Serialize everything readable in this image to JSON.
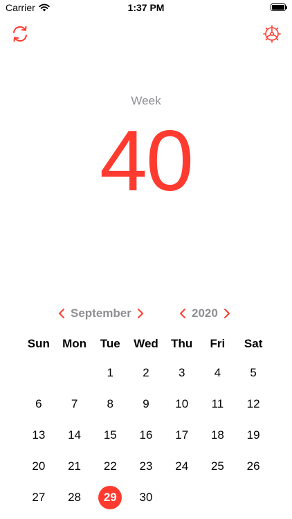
{
  "status_bar": {
    "carrier": "Carrier",
    "time": "1:37 PM"
  },
  "toolbar": {
    "left_icon": "refresh-icon",
    "right_icon": "settings-gear-icon"
  },
  "week": {
    "label": "Week",
    "number": "40"
  },
  "month_picker": {
    "value": "September"
  },
  "year_picker": {
    "value": "2020"
  },
  "calendar": {
    "weekdays": [
      "Sun",
      "Mon",
      "Tue",
      "Wed",
      "Thu",
      "Fri",
      "Sat"
    ],
    "weeks": [
      [
        "",
        "",
        "1",
        "2",
        "3",
        "4",
        "5"
      ],
      [
        "6",
        "7",
        "8",
        "9",
        "10",
        "11",
        "12"
      ],
      [
        "13",
        "14",
        "15",
        "16",
        "17",
        "18",
        "19"
      ],
      [
        "20",
        "21",
        "22",
        "23",
        "24",
        "25",
        "26"
      ],
      [
        "27",
        "28",
        "29",
        "30",
        "",
        "",
        ""
      ]
    ],
    "selected_day": "29"
  },
  "colors": {
    "accent": "#ff3b30",
    "secondary_text": "#8e8e93"
  }
}
